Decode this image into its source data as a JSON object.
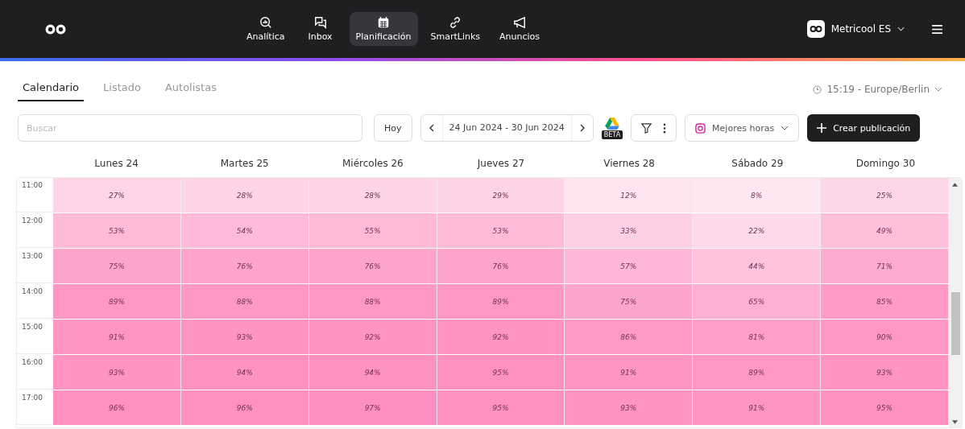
{
  "nav": [
    {
      "label": "Analítica",
      "selected": false
    },
    {
      "label": "Inbox",
      "selected": false
    },
    {
      "label": "Planificación",
      "selected": true
    },
    {
      "label": "SmartLinks",
      "selected": false
    },
    {
      "label": "Anuncios",
      "selected": false
    }
  ],
  "account": {
    "name": "Metricool ES"
  },
  "tabs": [
    {
      "label": "Calendario",
      "selected": true
    },
    {
      "label": "Listado",
      "selected": false
    },
    {
      "label": "Autolistas",
      "selected": false
    }
  ],
  "timezone": "15:19 - Europe/Berlin",
  "search": {
    "placeholder": "Buscar"
  },
  "today_button": "Hoy",
  "date_range": "24 Jun 2024 - 30 Jun 2024",
  "drive_badge": "BETA",
  "best_hours": "Mejores horas",
  "create_button": "Crear publicación",
  "days": [
    "Lunes 24",
    "Martes 25",
    "Miércoles 26",
    "Jueves 27",
    "Viernes 28",
    "Sábado 29",
    "Domingo 30"
  ],
  "rows": [
    {
      "time": "11:00",
      "cells": [
        {
          "text": "27%",
          "color": "#fdd5e7"
        },
        {
          "text": "28%",
          "color": "#fdd4e6"
        },
        {
          "text": "28%",
          "color": "#fdd4e6"
        },
        {
          "text": "29%",
          "color": "#fdd3e6"
        },
        {
          "text": "12%",
          "color": "#fde4ef"
        },
        {
          "text": "8%",
          "color": "#fde8f2"
        },
        {
          "text": "25%",
          "color": "#fdd7e8"
        }
      ]
    },
    {
      "time": "12:00",
      "cells": [
        {
          "text": "53%",
          "color": "#febbd8"
        },
        {
          "text": "54%",
          "color": "#febad8"
        },
        {
          "text": "55%",
          "color": "#feb9d7"
        },
        {
          "text": "53%",
          "color": "#febbd8"
        },
        {
          "text": "33%",
          "color": "#fdcfe4"
        },
        {
          "text": "22%",
          "color": "#fddaea"
        },
        {
          "text": "49%",
          "color": "#febfdb"
        }
      ]
    },
    {
      "time": "13:00",
      "cells": [
        {
          "text": "75%",
          "color": "#fea5cc"
        },
        {
          "text": "76%",
          "color": "#fea4cb"
        },
        {
          "text": "76%",
          "color": "#fea4cb"
        },
        {
          "text": "76%",
          "color": "#fea4cb"
        },
        {
          "text": "57%",
          "color": "#feb7d6"
        },
        {
          "text": "44%",
          "color": "#fec4dd"
        },
        {
          "text": "71%",
          "color": "#fea9ce"
        }
      ]
    },
    {
      "time": "14:00",
      "cells": [
        {
          "text": "89%",
          "color": "#ff97c4"
        },
        {
          "text": "88%",
          "color": "#ff98c5"
        },
        {
          "text": "88%",
          "color": "#ff98c5"
        },
        {
          "text": "89%",
          "color": "#ff97c4"
        },
        {
          "text": "75%",
          "color": "#fea5cc"
        },
        {
          "text": "65%",
          "color": "#feafd2"
        },
        {
          "text": "85%",
          "color": "#ff9bc6"
        }
      ]
    },
    {
      "time": "15:00",
      "cells": [
        {
          "text": "91%",
          "color": "#ff95c3"
        },
        {
          "text": "93%",
          "color": "#ff93c2"
        },
        {
          "text": "92%",
          "color": "#ff94c2"
        },
        {
          "text": "92%",
          "color": "#ff94c2"
        },
        {
          "text": "86%",
          "color": "#ff9ac6"
        },
        {
          "text": "81%",
          "color": "#ff9fc9"
        },
        {
          "text": "90%",
          "color": "#ff96c4"
        }
      ]
    },
    {
      "time": "16:00",
      "cells": [
        {
          "text": "93%",
          "color": "#ff93c2"
        },
        {
          "text": "94%",
          "color": "#ff92c1"
        },
        {
          "text": "94%",
          "color": "#ff92c1"
        },
        {
          "text": "95%",
          "color": "#ff91c1"
        },
        {
          "text": "91%",
          "color": "#ff95c3"
        },
        {
          "text": "89%",
          "color": "#ff97c4"
        },
        {
          "text": "93%",
          "color": "#ff93c2"
        }
      ]
    },
    {
      "time": "17:00",
      "cells": [
        {
          "text": "96%",
          "color": "#ff90c0"
        },
        {
          "text": "96%",
          "color": "#ff90c0"
        },
        {
          "text": "97%",
          "color": "#ff8fc0"
        },
        {
          "text": "95%",
          "color": "#ff91c1"
        },
        {
          "text": "93%",
          "color": "#ff93c2"
        },
        {
          "text": "91%",
          "color": "#ff95c3"
        },
        {
          "text": "95%",
          "color": "#ff91c1"
        }
      ]
    }
  ]
}
